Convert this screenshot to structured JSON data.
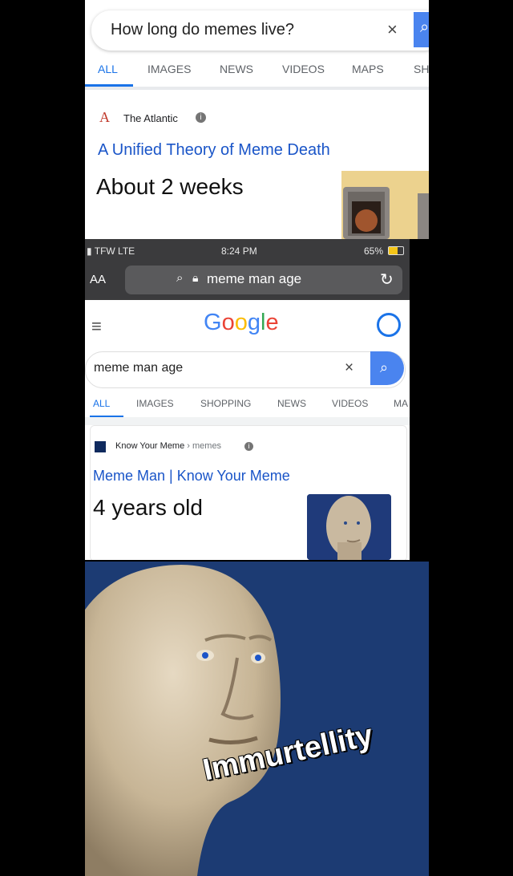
{
  "panel1": {
    "query": "How long do memes live?",
    "clear_icon": "×",
    "tabs": [
      "ALL",
      "IMAGES",
      "NEWS",
      "VIDEOS",
      "MAPS",
      "SH"
    ],
    "source_logo": "A",
    "source": "The Atlantic",
    "result_title": "A Unified Theory of Meme Death",
    "answer": "About 2 weeks",
    "colors": {
      "link": "#1a55c8",
      "accent": "#1a73e8",
      "search_button": "#4a84ef"
    }
  },
  "panel2": {
    "status": {
      "carrier": "TFW  LTE",
      "time": "8:24 PM",
      "battery": "65%"
    },
    "browser": {
      "text_size": "AA",
      "url": "meme man age"
    },
    "google_logo": [
      "G",
      "o",
      "o",
      "g",
      "l",
      "e"
    ],
    "query": "meme man age",
    "clear_icon": "×",
    "tabs": [
      "ALL",
      "IMAGES",
      "SHOPPING",
      "NEWS",
      "VIDEOS",
      "MA"
    ],
    "source": "Know Your Meme",
    "source_sub": "› memes",
    "result_title": "Meme Man | Know Your Meme",
    "answer": "4 years old",
    "colors": {
      "google_blue": "#4285f4",
      "google_red": "#ea4335",
      "google_yellow": "#fbbc05",
      "google_green": "#34a853"
    }
  },
  "panel3": {
    "caption": "Immurtellity",
    "background": "#1c3b73"
  }
}
